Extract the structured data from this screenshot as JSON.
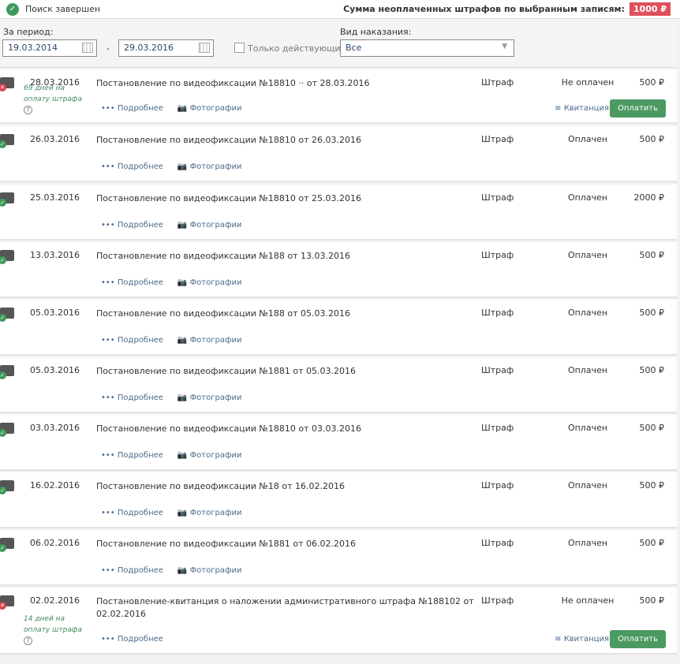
{
  "status": "Поиск завершен",
  "sum_label": "Сумма неоплаченных штрафов по выбранным записям:",
  "sum_value": "1000 ₽",
  "filters": {
    "period_label": "За период:",
    "from": "19.03.2014",
    "dash": "-",
    "to": "29.03.2016",
    "active_only": "Только действующие",
    "type_label": "Вид наказания:",
    "type_value": "Все"
  },
  "labels": {
    "more": "Подробнее",
    "photos": "Фотографии",
    "receipt": "Квитанция",
    "pay": "Оплатить",
    "days_suffix": "дней на оплату штрафа"
  },
  "rows": [
    {
      "date": "28.03.2016",
      "desc": "Постановление по видеофиксации №18810 ·· от 28.03.2016",
      "kind": "Штраф",
      "status": "Не оплачен",
      "amount": "500 ₽",
      "paid": false,
      "days": "69 дней на оплату штрафа",
      "photos": true
    },
    {
      "date": "26.03.2016",
      "desc": "Постановление по видеофиксации №18810 от 26.03.2016",
      "kind": "Штраф",
      "status": "Оплачен",
      "amount": "500 ₽",
      "paid": true,
      "photos": true
    },
    {
      "date": "25.03.2016",
      "desc": "Постановление по видеофиксации №18810 от 25.03.2016",
      "kind": "Штраф",
      "status": "Оплачен",
      "amount": "2000 ₽",
      "paid": true,
      "photos": true
    },
    {
      "date": "13.03.2016",
      "desc": "Постановление по видеофиксации №188 от 13.03.2016",
      "kind": "Штраф",
      "status": "Оплачен",
      "amount": "500 ₽",
      "paid": true,
      "photos": true
    },
    {
      "date": "05.03.2016",
      "desc": "Постановление по видеофиксации №188 от 05.03.2016",
      "kind": "Штраф",
      "status": "Оплачен",
      "amount": "500 ₽",
      "paid": true,
      "photos": true
    },
    {
      "date": "05.03.2016",
      "desc": "Постановление по видеофиксации №1881 от 05.03.2016",
      "kind": "Штраф",
      "status": "Оплачен",
      "amount": "500 ₽",
      "paid": true,
      "photos": true
    },
    {
      "date": "03.03.2016",
      "desc": "Постановление по видеофиксации №18810 от 03.03.2016",
      "kind": "Штраф",
      "status": "Оплачен",
      "amount": "500 ₽",
      "paid": true,
      "photos": true
    },
    {
      "date": "16.02.2016",
      "desc": "Постановление по видеофиксации №18 от 16.02.2016",
      "kind": "Штраф",
      "status": "Оплачен",
      "amount": "500 ₽",
      "paid": true,
      "photos": true
    },
    {
      "date": "06.02.2016",
      "desc": "Постановление по видеофиксации №1881 от 06.02.2016",
      "kind": "Штраф",
      "status": "Оплачен",
      "amount": "500 ₽",
      "paid": true,
      "photos": true
    },
    {
      "date": "02.02.2016",
      "desc": "Постановление-квитанция о наложении административного штрафа №188102 от 02.02.2016",
      "kind": "Штраф",
      "status": "Не оплачен",
      "amount": "500 ₽",
      "paid": false,
      "days": "14 дней на оплату штрафа",
      "photos": false
    }
  ]
}
